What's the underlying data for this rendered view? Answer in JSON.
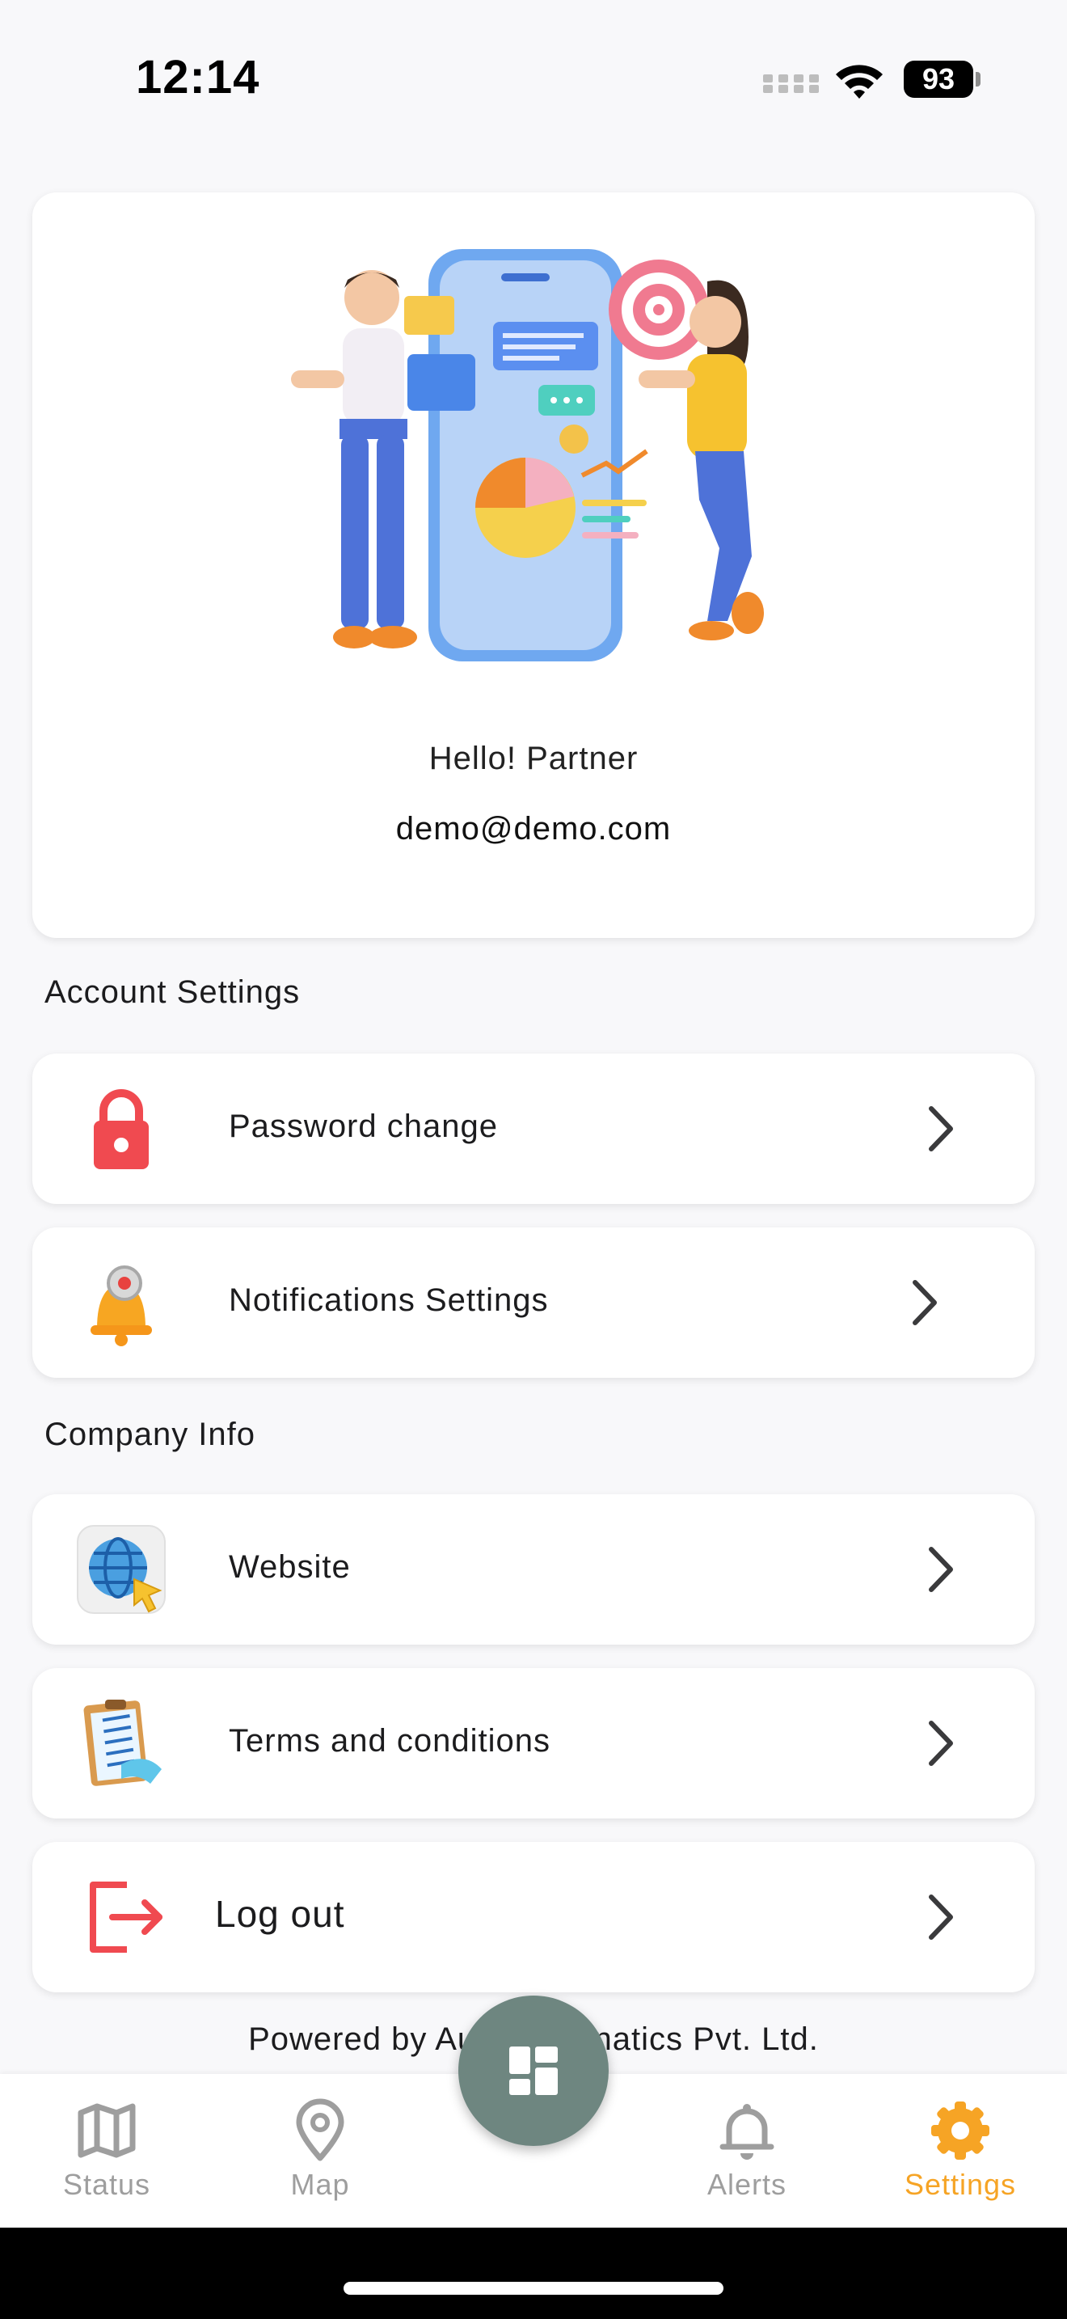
{
  "status_bar": {
    "time": "12:14",
    "battery": "93"
  },
  "profile": {
    "greeting": "Hello! Partner",
    "email": "demo@demo.com"
  },
  "sections": {
    "account": {
      "title": "Account Settings",
      "items": [
        {
          "label": "Password change",
          "icon": "lock-icon"
        },
        {
          "label": "Notifications Settings",
          "icon": "bell-gear-icon"
        }
      ]
    },
    "company": {
      "title": "Company Info",
      "items": [
        {
          "label": "Website",
          "icon": "globe-cursor-icon"
        },
        {
          "label": "Terms and conditions",
          "icon": "clipboard-checklist-icon"
        }
      ]
    }
  },
  "logout": {
    "label": "Log out",
    "icon": "logout-icon"
  },
  "footer": {
    "powered_by": "Powered by Au            natics Pvt. Ltd."
  },
  "bottom_nav": {
    "items": [
      {
        "label": "Status",
        "icon": "map-icon",
        "active": false
      },
      {
        "label": "Map",
        "icon": "location-pin-icon",
        "active": false
      },
      {
        "label": "Alerts",
        "icon": "bell-icon",
        "active": false
      },
      {
        "label": "Settings",
        "icon": "gear-icon",
        "active": true
      }
    ],
    "fab_icon": "dashboard-icon"
  },
  "colors": {
    "accent": "#f6a425",
    "fab": "#6e8680",
    "danger": "#f04a50",
    "inactive": "#9e9e9e"
  }
}
